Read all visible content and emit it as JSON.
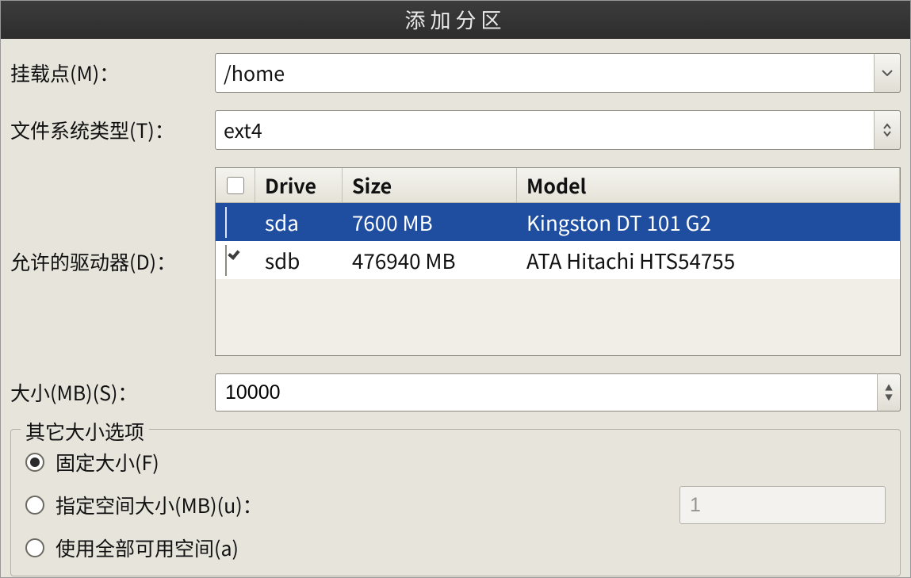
{
  "title": "添加分区",
  "labels": {
    "mount_point": "挂载点(M)：",
    "fs_type": "文件系统类型(T)：",
    "allowed_drives": "允许的驱动器(D)：",
    "size_mb": "大小(MB)(S)：",
    "other_size": "其它大小选项"
  },
  "fields": {
    "mount_point": "/home",
    "fs_type": "ext4",
    "size_mb": "10000",
    "specify_space_value": "1"
  },
  "drives": {
    "headers": {
      "check": "",
      "drive": "Drive",
      "size": "Size",
      "model": "Model"
    },
    "rows": [
      {
        "checked": false,
        "drive": "sda",
        "size": "7600 MB",
        "model": "Kingston DT 101 G2"
      },
      {
        "checked": true,
        "drive": "sdb",
        "size": "476940 MB",
        "model": "ATA Hitachi HTS54755"
      }
    ]
  },
  "size_options": {
    "fixed": "固定大小(F)",
    "specify": "指定空间大小(MB)(u)：",
    "all": "使用全部可用空间(a)",
    "selected": "fixed"
  }
}
